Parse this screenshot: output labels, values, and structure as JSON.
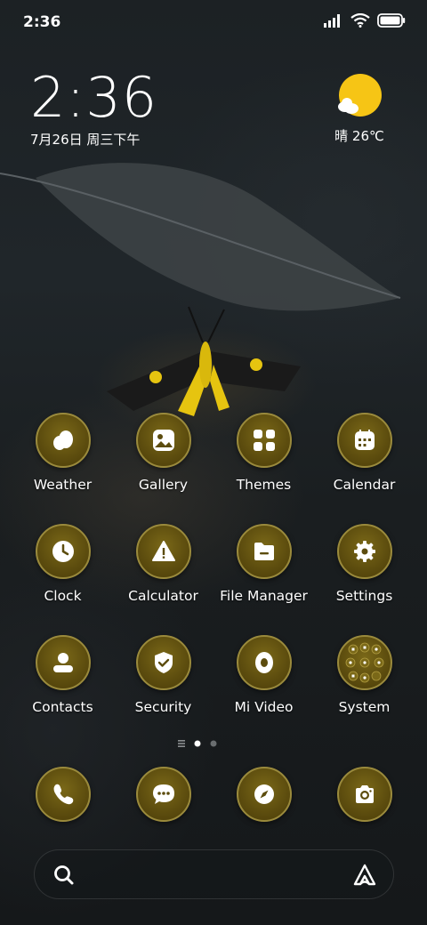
{
  "status_bar": {
    "time": "2:36",
    "signal_icon": "signal-icon",
    "wifi_icon": "wifi-icon",
    "battery_icon": "battery-icon"
  },
  "clock_widget": {
    "time": "2:36",
    "date": "7月26日 周三下午"
  },
  "weather_widget": {
    "icon": "sun-cloud-icon",
    "text": "晴 26℃"
  },
  "apps": [
    {
      "label": "Weather",
      "icon": "weather-icon"
    },
    {
      "label": "Gallery",
      "icon": "gallery-icon"
    },
    {
      "label": "Themes",
      "icon": "themes-icon"
    },
    {
      "label": "Calendar",
      "icon": "calendar-icon"
    },
    {
      "label": "Clock",
      "icon": "clock-icon"
    },
    {
      "label": "Calculator",
      "icon": "calculator-icon"
    },
    {
      "label": "File Manager",
      "icon": "file-manager-icon"
    },
    {
      "label": "Settings",
      "icon": "settings-icon"
    },
    {
      "label": "Contacts",
      "icon": "contacts-icon"
    },
    {
      "label": "Security",
      "icon": "security-icon"
    },
    {
      "label": "Mi Video",
      "icon": "mi-video-icon"
    },
    {
      "label": "System",
      "icon": "system-folder-icon"
    }
  ],
  "page_indicator": {
    "pages": 2,
    "active": 1
  },
  "dock": [
    {
      "icon": "phone-icon"
    },
    {
      "icon": "messages-icon"
    },
    {
      "icon": "browser-icon"
    },
    {
      "icon": "camera-icon"
    }
  ],
  "search_bar": {
    "search_icon": "search-icon",
    "assistant_icon": "assistant-icon"
  },
  "colors": {
    "icon_gold": "#5c4c0e",
    "icon_border": "#9a8a3c",
    "sun_yellow": "#f6c515"
  }
}
